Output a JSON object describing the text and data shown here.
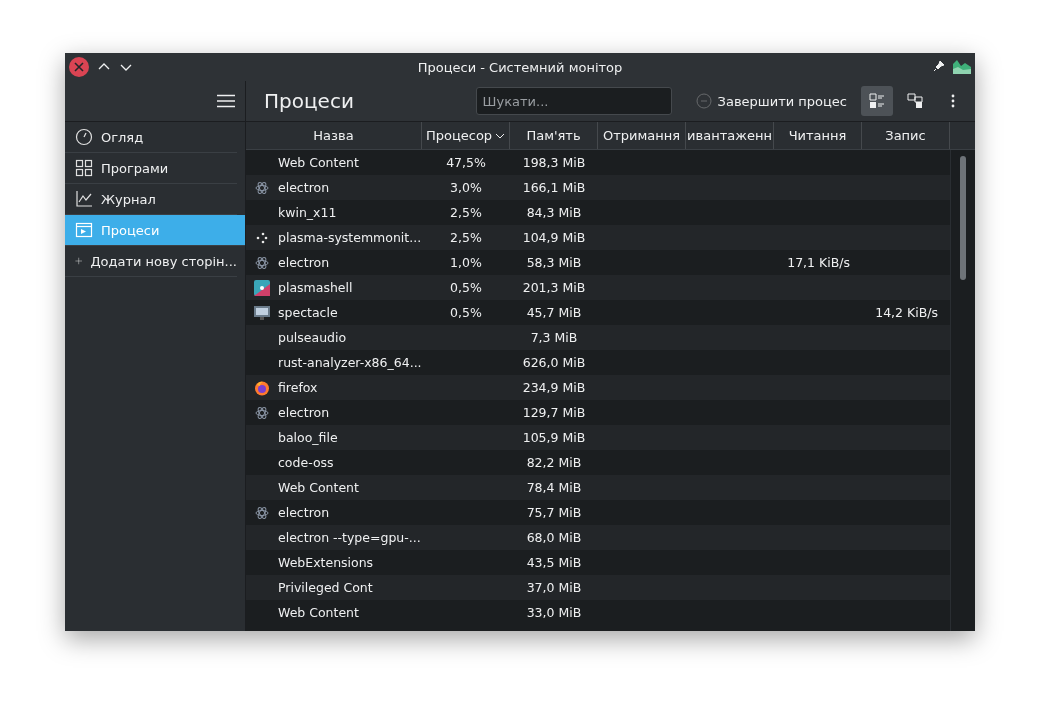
{
  "window": {
    "title": "Процеси - Системний монітор"
  },
  "sidebar": {
    "items": [
      {
        "label": "Огляд",
        "kind": "gauge",
        "selected": false
      },
      {
        "label": "Програми",
        "kind": "grid",
        "selected": false
      },
      {
        "label": "Журнал",
        "kind": "chart",
        "selected": false
      },
      {
        "label": "Процеси",
        "kind": "window",
        "selected": true
      },
      {
        "label": "Додати нову сторін...",
        "kind": "plus",
        "selected": false
      }
    ]
  },
  "page_title": "Процеси",
  "search": {
    "placeholder": "Шукати..."
  },
  "end_process_button": {
    "label": "Завершити процес",
    "disabled": true
  },
  "view_buttons": [
    {
      "kind": "list",
      "selected": true
    },
    {
      "kind": "tree",
      "selected": false
    }
  ],
  "table": {
    "columns": [
      {
        "label": "Назва",
        "sorted": false
      },
      {
        "label": "Процесор",
        "sorted": true
      },
      {
        "label": "Пам'ять",
        "sorted": false
      },
      {
        "label": "Отримання",
        "sorted": false
      },
      {
        "label": "ивантаженн",
        "sorted": false
      },
      {
        "label": "Читання",
        "sorted": false
      },
      {
        "label": "Запис",
        "sorted": false
      }
    ],
    "rows": [
      {
        "name": "Web Content",
        "cpu": "47,5%",
        "memory": "198,3 MiB"
      },
      {
        "kind": "atom",
        "name": "electron",
        "cpu": "3,0%",
        "memory": "166,1 MiB"
      },
      {
        "name": "kwin_x11",
        "cpu": "2,5%",
        "memory": "84,3 MiB"
      },
      {
        "kind": "dots",
        "name": "plasma-systemmonit...",
        "cpu": "2,5%",
        "memory": "104,9 MiB"
      },
      {
        "kind": "atom",
        "name": "electron",
        "cpu": "1,0%",
        "memory": "58,3 MiB",
        "read": "17,1 KiB/s"
      },
      {
        "kind": "plasma",
        "name": "plasmashell",
        "cpu": "0,5%",
        "memory": "201,3 MiB"
      },
      {
        "kind": "monitor",
        "name": "spectacle",
        "cpu": "0,5%",
        "memory": "45,7 MiB",
        "write": "14,2 KiB/s"
      },
      {
        "name": "pulseaudio",
        "memory": "7,3 MiB"
      },
      {
        "name": "rust-analyzer-x86_64...",
        "memory": "626,0 MiB"
      },
      {
        "kind": "fox",
        "name": "firefox",
        "memory": "234,9 MiB"
      },
      {
        "kind": "atom",
        "name": "electron",
        "memory": "129,7 MiB"
      },
      {
        "name": "baloo_file",
        "memory": "105,9 MiB"
      },
      {
        "name": "code-oss",
        "memory": "82,2 MiB"
      },
      {
        "name": "Web Content",
        "memory": "78,4 MiB"
      },
      {
        "kind": "atom",
        "name": "electron",
        "memory": "75,7 MiB"
      },
      {
        "name": "electron --type=gpu-...",
        "memory": "68,0 MiB"
      },
      {
        "name": "WebExtensions",
        "memory": "43,5 MiB"
      },
      {
        "name": "Privileged Cont",
        "memory": "37,0 MiB"
      },
      {
        "name": "Web Content",
        "memory": "33,0 MiB"
      }
    ]
  }
}
